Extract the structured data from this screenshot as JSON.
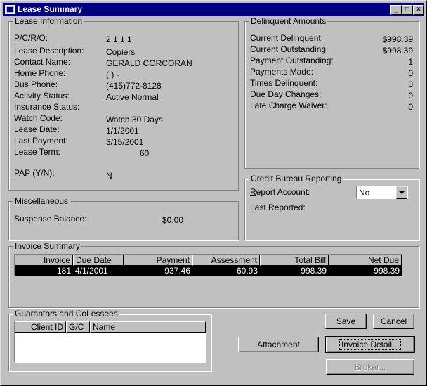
{
  "window": {
    "title": "Lease Summary",
    "min_glyph": "_",
    "max_glyph": "□",
    "close_glyph": "×"
  },
  "lease_info": {
    "title": "Lease Information",
    "rows": [
      {
        "label": "P/C/R/O:",
        "value": "2  1  1  1"
      },
      {
        "label": "Lease Description:",
        "value": "Copiers"
      },
      {
        "label": "Contact Name:",
        "value": "GERALD CORCORAN"
      },
      {
        "label": "Home Phone:",
        "value": "(   )   -"
      },
      {
        "label": "Bus Phone:",
        "value": "(415)772-8128"
      },
      {
        "label": "Activity Status:",
        "value": "Active Normal"
      },
      {
        "label": "Insurance Status:",
        "value": ""
      },
      {
        "label": "Watch Code:",
        "value": "Watch 30 Days"
      },
      {
        "label": "Lease Date:",
        "value": "1/1/2001"
      },
      {
        "label": "Last Payment:",
        "value": "3/15/2001"
      },
      {
        "label": "Lease Term:",
        "value": "60"
      }
    ],
    "pap_label": "PAP (Y/N):",
    "pap_value": "N"
  },
  "delinquent": {
    "title": "Delinquent Amounts",
    "rows": [
      {
        "label": "Current Delinquent:",
        "value": "$998.39"
      },
      {
        "label": "Current Outstanding:",
        "value": "$998.39"
      },
      {
        "label": "Payment Outstanding:",
        "value": "1"
      },
      {
        "label": "Payments Made:",
        "value": "0"
      },
      {
        "label": "Times Delinquent:",
        "value": "0"
      },
      {
        "label": "Due Day Changes:",
        "value": "0"
      },
      {
        "label": "Late Charge Waiver:",
        "value": "0"
      }
    ]
  },
  "misc": {
    "title": "Miscellaneous",
    "suspense_label": "Suspense Balance:",
    "suspense_value": "$0.00"
  },
  "credit_bureau": {
    "title": "Credit Bureau Reporting",
    "report_account_label": "Report Account:",
    "report_account_value": "No",
    "last_reported_label": "Last Reported:"
  },
  "invoice_summary": {
    "title": "Invoice Summary",
    "columns": [
      "Invoice",
      "Due Date",
      "Payment",
      "Assessment",
      "Total Bill",
      "Net Due"
    ],
    "rows": [
      [
        "181",
        "4/1/2001",
        "937.46",
        "60.93",
        "998.39",
        "998.39"
      ]
    ]
  },
  "guarantors": {
    "title": "Guarantors and CoLessees",
    "columns": [
      "Client ID",
      "G/C",
      "Name"
    ]
  },
  "buttons": {
    "save": "Save",
    "cancel": "Cancel",
    "attachment": "Attachment",
    "invoice_detail": "Invoice Detail...",
    "broker": "Broker..."
  }
}
